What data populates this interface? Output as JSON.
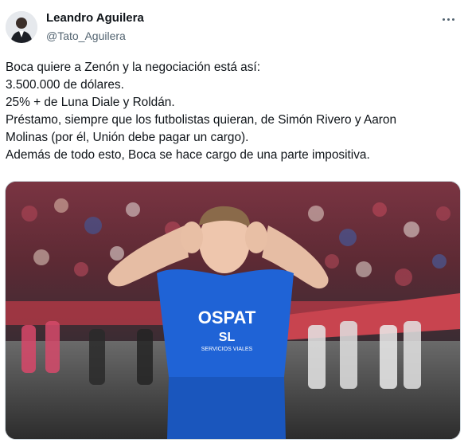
{
  "author": {
    "name": "Leandro Aguilera",
    "handle": "@Tato_Aguilera",
    "avatar_icon": "user-avatar-icon"
  },
  "more_icon": "more-options-icon",
  "tweet": {
    "lines": [
      "Boca quiere a Zenón y la negociación está así:",
      "3.500.000 de dólares.",
      "25% + de Luna Diale y Roldán.",
      "Préstamo, siempre que los futbolistas quieran, de Simón Rivero y Aaron",
      "Molinas (por él, Unión debe pagar un cargo).",
      "Además de todo esto, Boca se hace cargo de una parte impositiva."
    ]
  },
  "photo": {
    "jersey_sponsor": "OSPAT",
    "jersey_sub": "SL",
    "jersey_caption": "SERVICIOS VIALES",
    "jersey_color": "#1f63d6",
    "crowd_color": "#6b2d38"
  }
}
